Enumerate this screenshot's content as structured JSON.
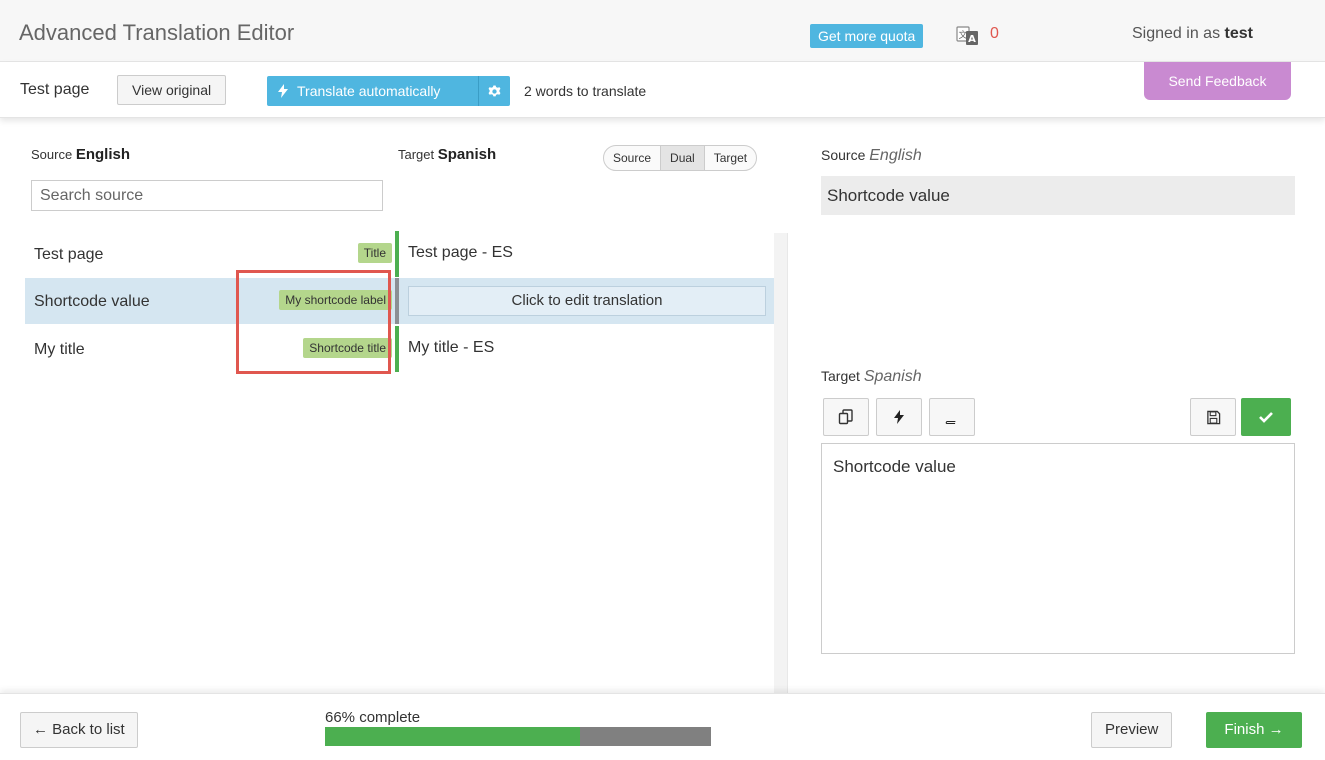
{
  "header": {
    "title": "Advanced Translation Editor",
    "quota_button": "Get more quota",
    "quota_count": "0",
    "signed_in_prefix": "Signed in as ",
    "user": "test"
  },
  "toolbar": {
    "page_name": "Test page",
    "view_original": "View original",
    "translate_auto": "Translate automatically",
    "words_left": "2 words to translate",
    "send_feedback": "Send Feedback"
  },
  "list": {
    "source_label": "Source",
    "source_lang": "English",
    "target_label": "Target",
    "target_lang": "Spanish",
    "search_placeholder": "Search source",
    "view_modes": [
      "Source",
      "Dual",
      "Target"
    ],
    "active_view": "Dual",
    "rows": [
      {
        "source": "Test page",
        "tag": "Title",
        "target": "Test page - ES",
        "status": "translated"
      },
      {
        "source": "Shortcode value",
        "tag": "My shortcode label",
        "target": "Click to edit translation",
        "status": "selected"
      },
      {
        "source": "My title",
        "tag": "Shortcode title",
        "target": "My title - ES",
        "status": "translated"
      }
    ]
  },
  "editor": {
    "source_label": "Source",
    "source_lang": "English",
    "source_text": "Shortcode value",
    "target_label": "Target",
    "target_lang": "Spanish",
    "target_text": "Shortcode value",
    "tools": [
      "copy-icon",
      "bolt-icon",
      "book-icon",
      "save-icon",
      "check-icon"
    ]
  },
  "footer": {
    "back": "← Back to list",
    "progress_label": "66% complete",
    "progress_fraction": 0.66,
    "preview": "Preview",
    "finish": "Finish →"
  },
  "colors": {
    "accent_blue": "#4fb6e0",
    "green": "#4caf50",
    "tag_green": "#b4d68c",
    "feedback_purple": "#c98ad1",
    "highlight_red": "#e0574f",
    "selected_row": "#d5e6f1"
  }
}
